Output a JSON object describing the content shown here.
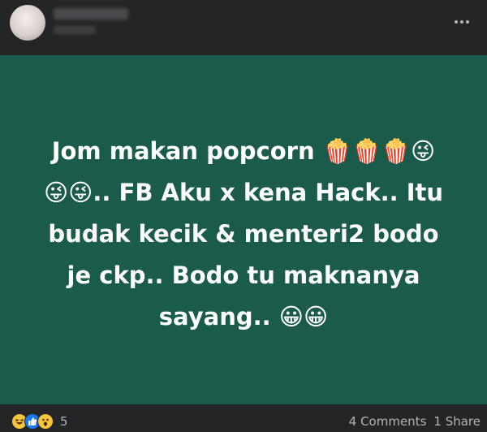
{
  "header": {
    "author_name": "",
    "more_icon": "more-options-icon"
  },
  "post": {
    "background_color": "#1a5b4c",
    "text_lines": [
      "Jom makan popcorn 🍿🍿🍿😜",
      "😜😜.. FB Aku x kena Hack.. Itu",
      "budak kecik & menteri2 bodo",
      "je ckp.. Bodo tu maknanya",
      "sayang.. 😀😀"
    ]
  },
  "footer": {
    "reaction_icons": [
      "haha-reaction-icon",
      "like-reaction-icon",
      "wow-reaction-icon"
    ],
    "reaction_count": "5",
    "comments_label": "4 Comments",
    "shares_label": "1 Share"
  }
}
